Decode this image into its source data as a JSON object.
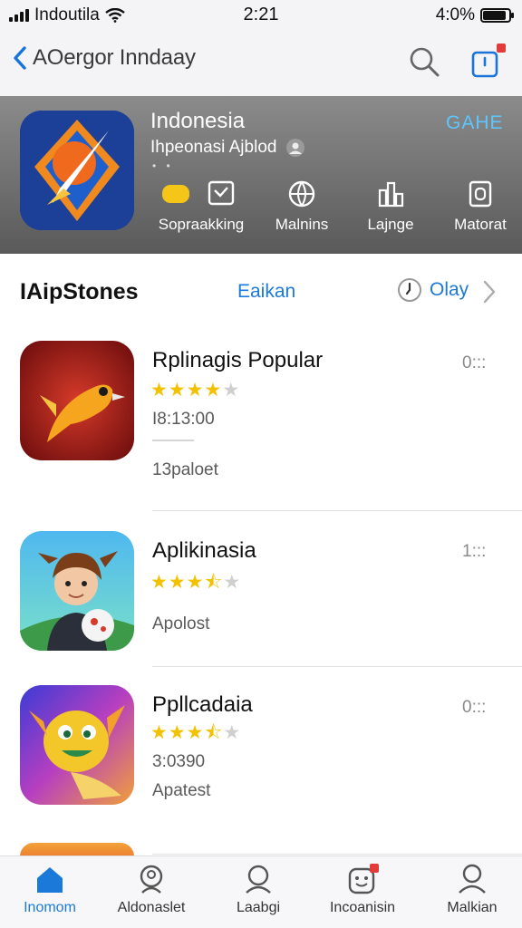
{
  "status_bar": {
    "carrier": "Indoutila",
    "time": "2:21",
    "battery_text": "4:0%",
    "battery_level": 0.9
  },
  "nav": {
    "back_title": "AOergor Inndaay"
  },
  "banner": {
    "title": "Indonesia",
    "subtitle": "Ihpeonasi Ajblod",
    "subdots": "• •",
    "get_label": "GAHE",
    "categories": [
      {
        "label": "Sopraakking",
        "icon": "pass-icon"
      },
      {
        "label": "Malnins",
        "icon": "globe-icon"
      },
      {
        "label": "Lajnge",
        "icon": "chart-icon"
      },
      {
        "label": "Matorat",
        "icon": "tablet-icon"
      }
    ]
  },
  "section": {
    "title": "IAipStones",
    "link": "Eaikan",
    "play_label": "Olay"
  },
  "apps": [
    {
      "name": "Rplinagis Popular",
      "rating": 4,
      "meta": "I8:13:00",
      "sub": "13paloet",
      "size": "0:::"
    },
    {
      "name": "Aplikinasia",
      "rating": 3.5,
      "meta": "",
      "sub": "Apolost",
      "size": "1:::"
    },
    {
      "name": "Ppllcadaia",
      "rating": 3.5,
      "meta": "3:0390",
      "sub": "Apatest",
      "size": "0:::"
    }
  ],
  "tabs": [
    {
      "label": "Inomom",
      "icon": "home-icon",
      "active": true
    },
    {
      "label": "Aldonaslet",
      "icon": "person-search-icon",
      "active": false
    },
    {
      "label": "Laabgi",
      "icon": "person-icon",
      "active": false
    },
    {
      "label": "Incoanisin",
      "icon": "face-icon",
      "active": false
    },
    {
      "label": "Malkian",
      "icon": "profile-icon",
      "active": false
    }
  ],
  "colors": {
    "accent": "#1b7ad9",
    "star": "#f2c200",
    "banner": "#6e6e6e"
  }
}
